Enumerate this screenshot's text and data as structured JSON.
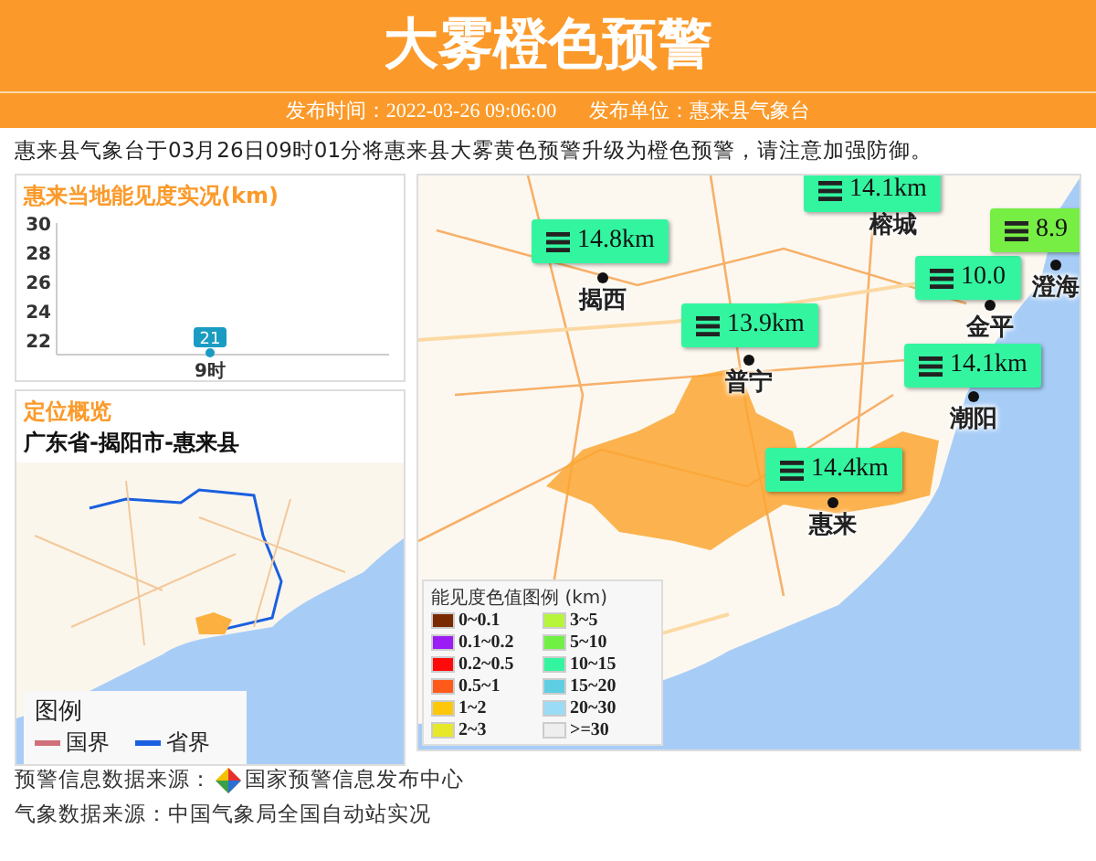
{
  "header": {
    "title": "大雾橙色预警",
    "publish_time": "发布时间：2022-03-26 09:06:00",
    "publisher": "发布单位：惠来县气象台"
  },
  "summary": "惠来县气象台于03月26日09时01分将惠来县大雾黄色预警升级为橙色预警，请注意加强防御。",
  "visibility_panel": {
    "title": "惠来当地能见度实况(km)",
    "chart_data": {
      "type": "line",
      "categories": [
        "9时"
      ],
      "series": [
        {
          "color": "#1a9bc2",
          "marker": true,
          "values": [
            21
          ]
        }
      ],
      "ylim": [
        21,
        30
      ],
      "yticks": [
        22,
        24,
        26,
        28,
        30
      ],
      "data_labels": true
    }
  },
  "location_panel": {
    "title": "定位概览",
    "path": "广东省-揭阳市-惠来县",
    "legend": {
      "title": "图例",
      "items": [
        {
          "label": "国界",
          "color": "#d0707a"
        },
        {
          "label": "省界",
          "color": "#1a5fe0"
        }
      ]
    }
  },
  "map": {
    "stations": [
      {
        "value": "14.1km",
        "color": "#33f5a0"
      },
      {
        "value": "14.8km",
        "color": "#33f5a0"
      },
      {
        "value": "10.0",
        "color": "#33f5a0"
      },
      {
        "value": "8.9",
        "color": "#77ee44"
      },
      {
        "value": "13.9km",
        "color": "#33f5a0"
      },
      {
        "value": "14.1km",
        "color": "#33f5a0"
      },
      {
        "value": "14.4km",
        "color": "#33f5a0"
      }
    ],
    "cities": [
      "榕城",
      "揭西",
      "澄海",
      "金平",
      "普宁",
      "潮阳",
      "惠来"
    ],
    "legend": {
      "title": "能见度色值图例",
      "unit": "(km)",
      "items": [
        {
          "label": "0~0.1",
          "color": "#7a2a00"
        },
        {
          "label": "3~5",
          "color": "#b6f53a"
        },
        {
          "label": "0.1~0.2",
          "color": "#9b1cf5"
        },
        {
          "label": "5~10",
          "color": "#70f042"
        },
        {
          "label": "0.2~0.5",
          "color": "#ff0a0a"
        },
        {
          "label": "10~15",
          "color": "#33f5a0"
        },
        {
          "label": "0.5~1",
          "color": "#ff5a1a"
        },
        {
          "label": "15~20",
          "color": "#5ecfe3"
        },
        {
          "label": "1~2",
          "color": "#ffc70a"
        },
        {
          "label": "20~30",
          "color": "#9adcf5"
        },
        {
          "label": "2~3",
          "color": "#e8e82a"
        },
        {
          "label": ">=30",
          "color": "#eeeeee"
        }
      ]
    }
  },
  "footer": {
    "warning_source_label": "预警信息数据来源：",
    "warning_source": "国家预警信息发布中心",
    "weather_source": "气象数据来源：中国气象局全国自动站实况"
  }
}
